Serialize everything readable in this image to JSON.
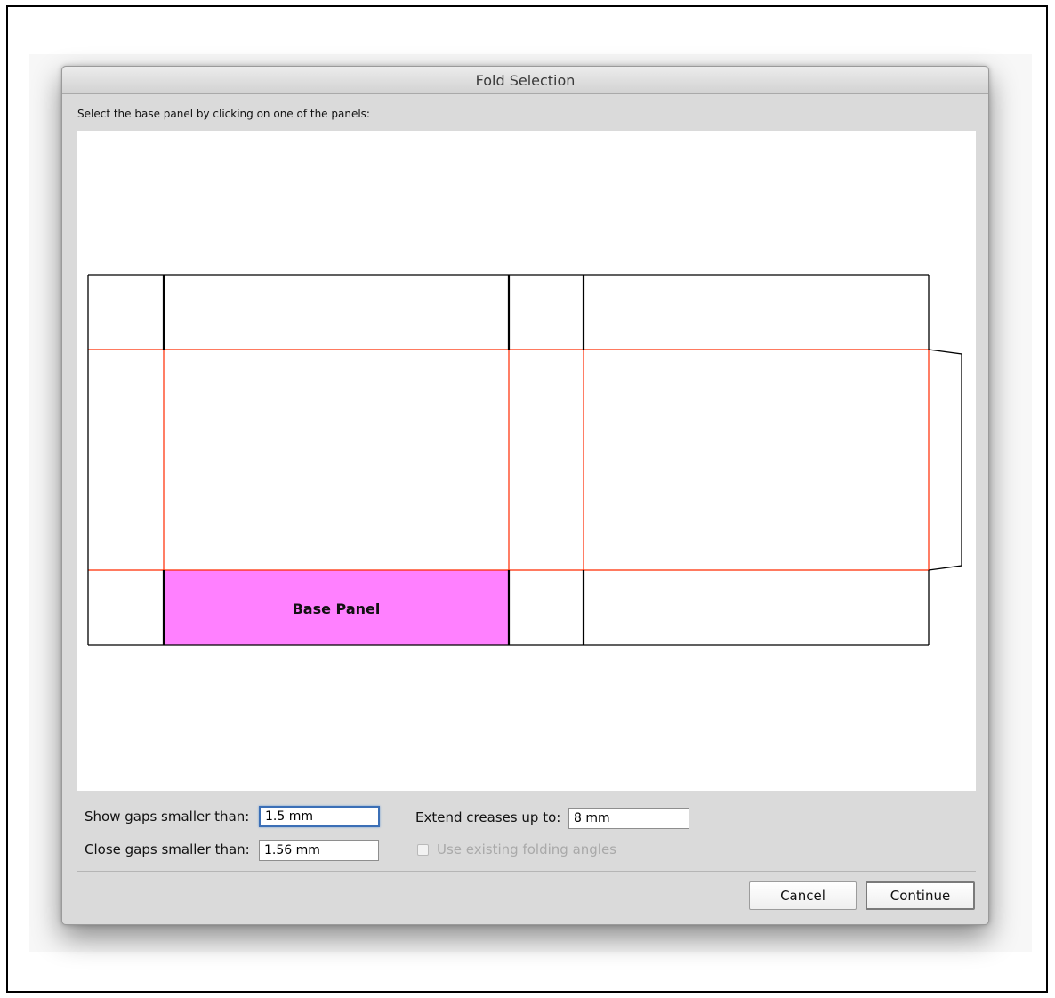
{
  "window": {
    "title": "Fold Selection"
  },
  "instruction": "Select the base panel by clicking on one of the panels:",
  "diagram": {
    "base_panel_label": "Base Panel",
    "colors": {
      "cut_line": "#000000",
      "crease_line": "#ff2a00",
      "base_panel_fill": "#ff80ff"
    }
  },
  "fields": {
    "show_gaps_label": "Show gaps smaller than:",
    "show_gaps_value": "1.5 mm",
    "close_gaps_label": "Close gaps smaller than:",
    "close_gaps_value": "1.56 mm",
    "extend_creases_label": "Extend creases up to:",
    "extend_creases_value": "8 mm"
  },
  "checkbox": {
    "label": "Use existing folding angles",
    "checked": false,
    "enabled": false
  },
  "buttons": {
    "cancel": "Cancel",
    "continue": "Continue"
  }
}
